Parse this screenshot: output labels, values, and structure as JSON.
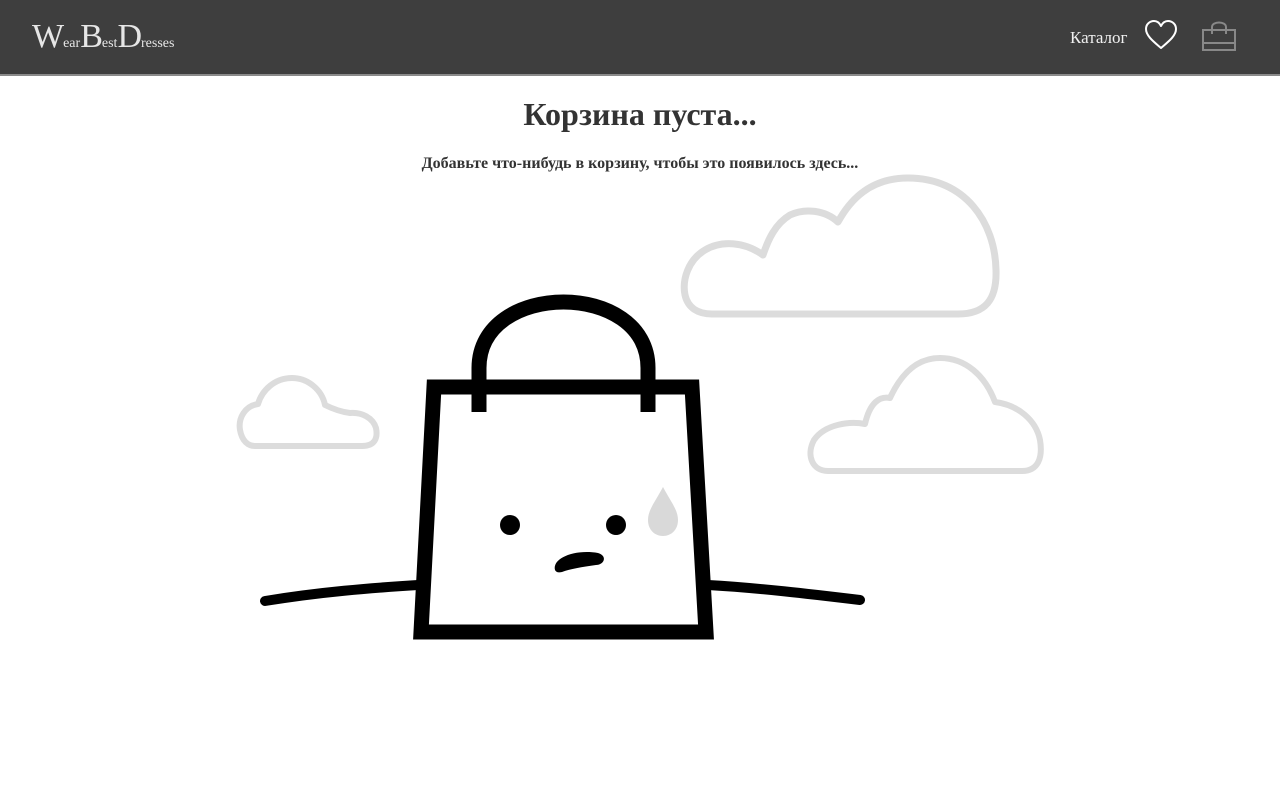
{
  "header": {
    "logo": {
      "parts": [
        {
          "cap": "W",
          "rest": "ear"
        },
        {
          "cap": "B",
          "rest": "est"
        },
        {
          "cap": "D",
          "rest": "resses"
        }
      ]
    },
    "nav": {
      "catalog_label": "Каталог",
      "favorites_icon": "heart-icon",
      "cart_icon": "shopping-bag-icon"
    }
  },
  "main": {
    "title": "Корзина пуста...",
    "subtitle": "Добавьте что-нибудь в корзину, чтобы это появилось здесь..."
  },
  "colors": {
    "header_bg": "#3e3e3e",
    "header_text": "#e6e6e6",
    "text": "#333333",
    "cloud": "#dcdcdc",
    "bag_stroke": "#000000"
  }
}
